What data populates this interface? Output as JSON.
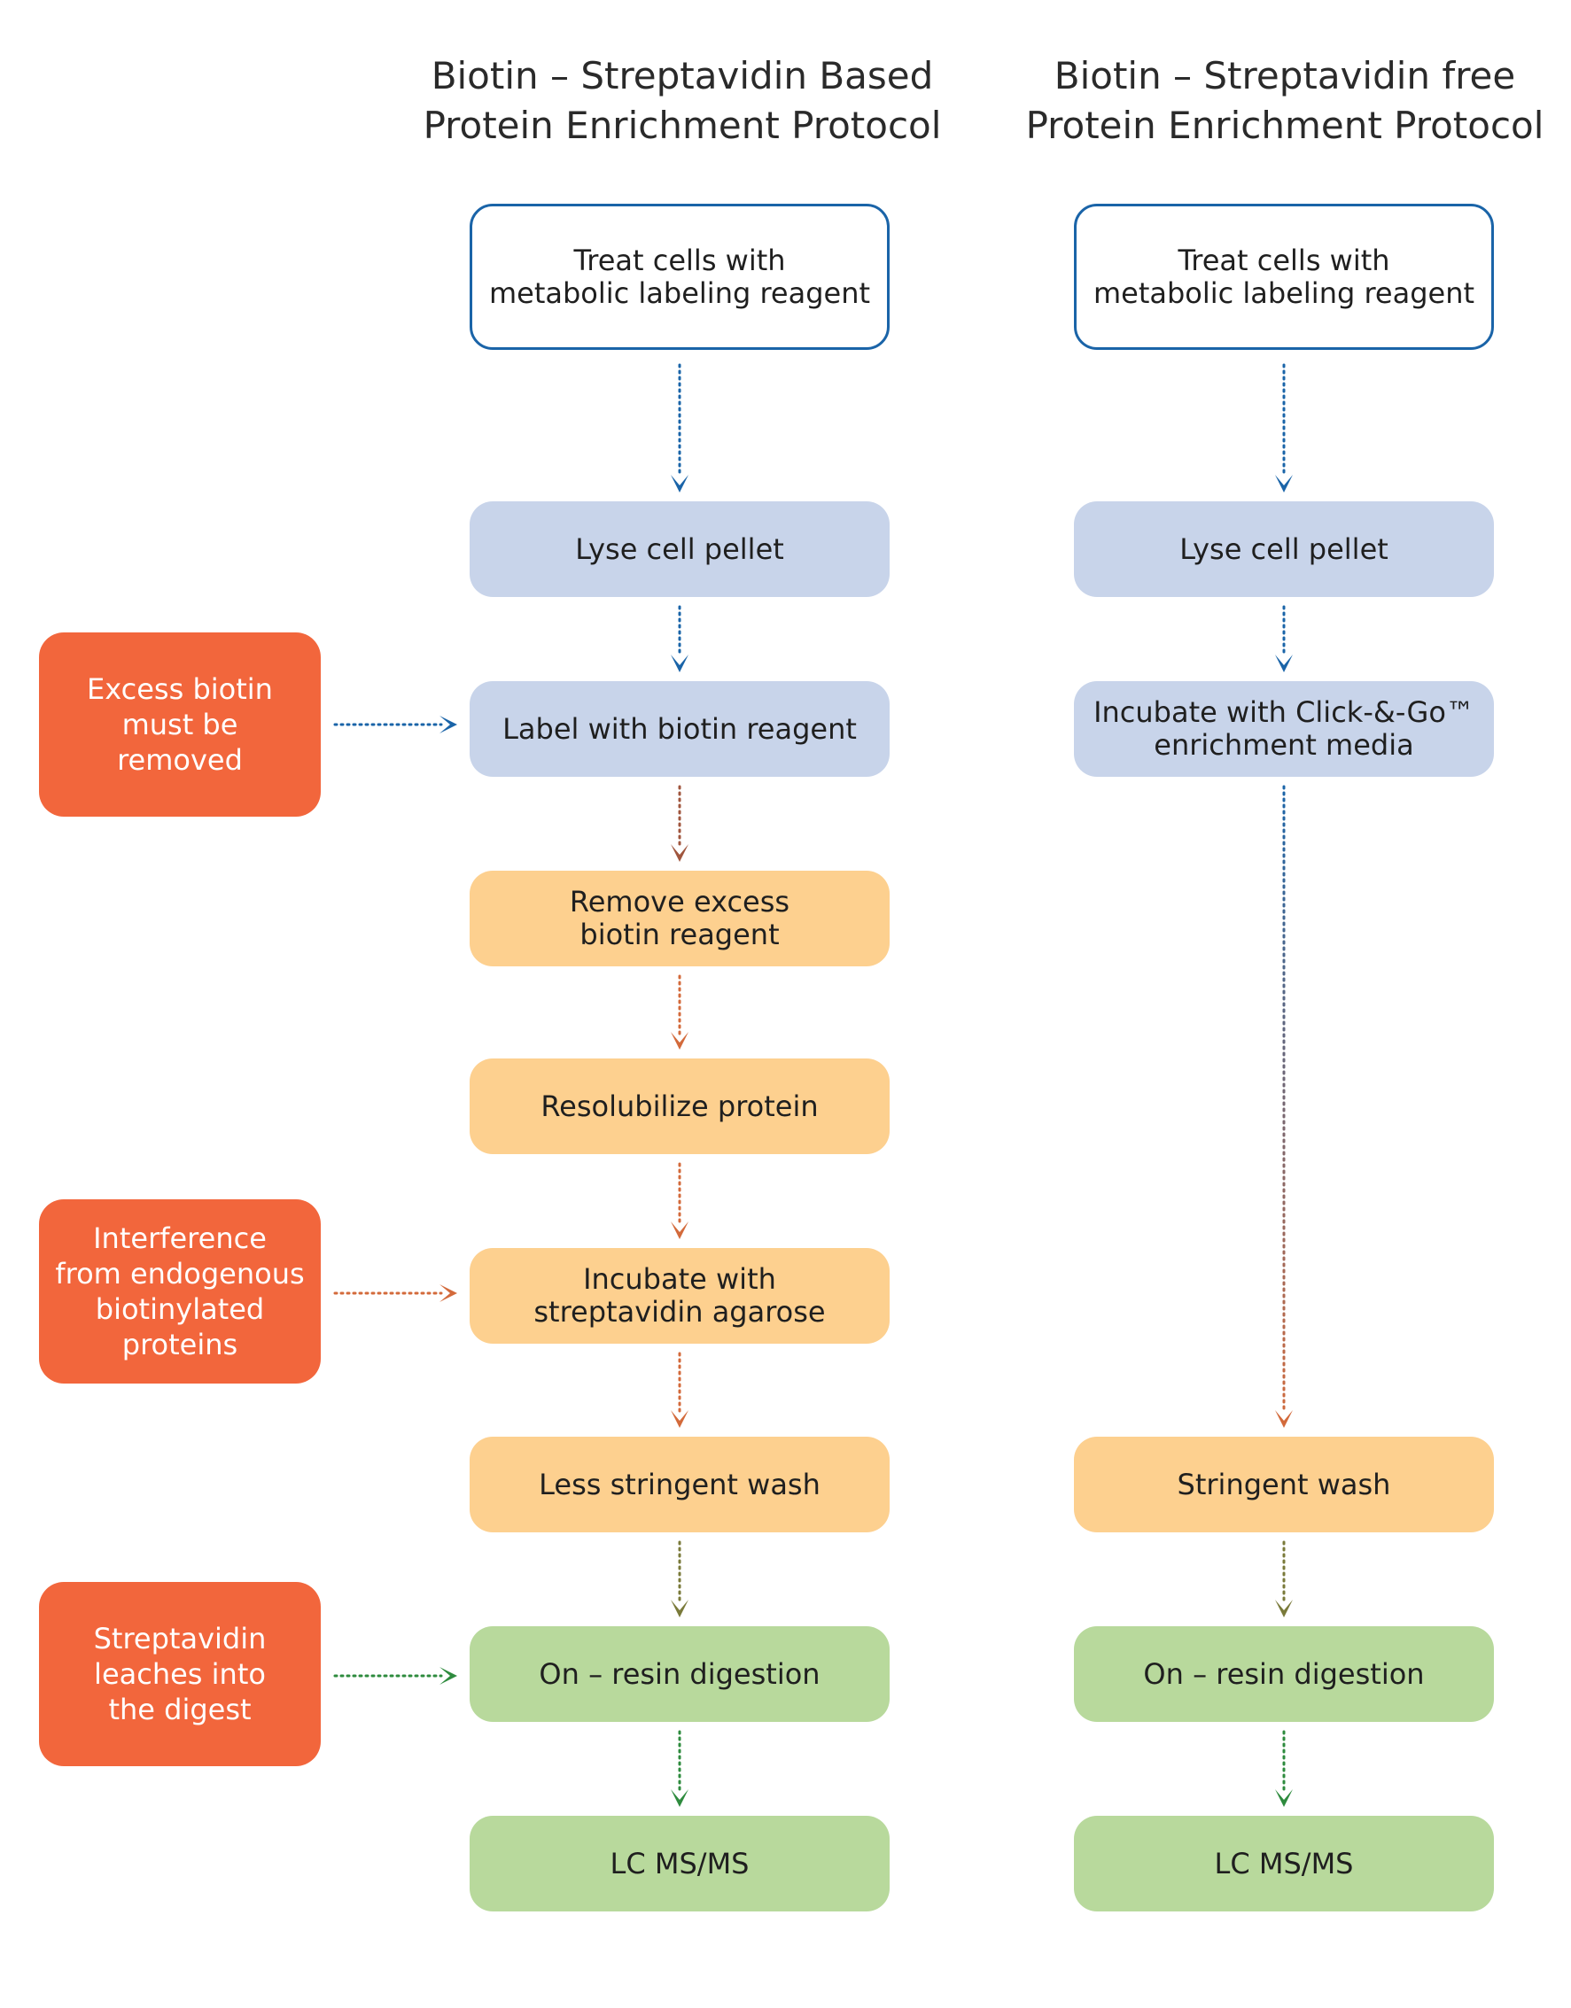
{
  "colors": {
    "outline_border": "#1a64a8",
    "lyse_fill": "#c8d4ea",
    "wash_fill": "#fdd08f",
    "digest_fill": "#b8d99c",
    "callout_fill": "#f2663c",
    "arrow_blue": "#1a64a8",
    "arrow_orange": "#d36a3b",
    "arrow_olive": "#7a7a3a",
    "arrow_green": "#2e8b3e"
  },
  "left_column": {
    "title_line1": "Biotin – Streptavidin Based",
    "title_line2": "Protein Enrichment Protocol",
    "steps": [
      {
        "label": "Treat cells with\nmetabolic labeling reagent"
      },
      {
        "label": "Lyse cell pellet"
      },
      {
        "label": "Label with biotin reagent"
      },
      {
        "label": "Remove excess\nbiotin reagent"
      },
      {
        "label": "Resolubilize protein"
      },
      {
        "label": "Incubate with\nstreptavidin agarose"
      },
      {
        "label": "Less stringent wash"
      },
      {
        "label": "On – resin digestion"
      },
      {
        "label": "LC MS/MS"
      }
    ]
  },
  "right_column": {
    "title_line1": "Biotin – Streptavidin free",
    "title_line2": "Protein Enrichment Protocol",
    "steps": [
      {
        "label": "Treat cells with\nmetabolic labeling reagent"
      },
      {
        "label": "Lyse cell pellet"
      },
      {
        "label": "Incubate with Click-&-Go™\nenrichment media"
      },
      {
        "label": "Stringent wash"
      },
      {
        "label": "On – resin digestion"
      },
      {
        "label": "LC MS/MS"
      }
    ]
  },
  "callouts": [
    {
      "label": "Excess biotin\nmust  be\nremoved"
    },
    {
      "label": "Interference\nfrom endogenous\nbiotinylated\nproteins"
    },
    {
      "label": "Streptavidin\nleaches into\nthe digest"
    }
  ]
}
